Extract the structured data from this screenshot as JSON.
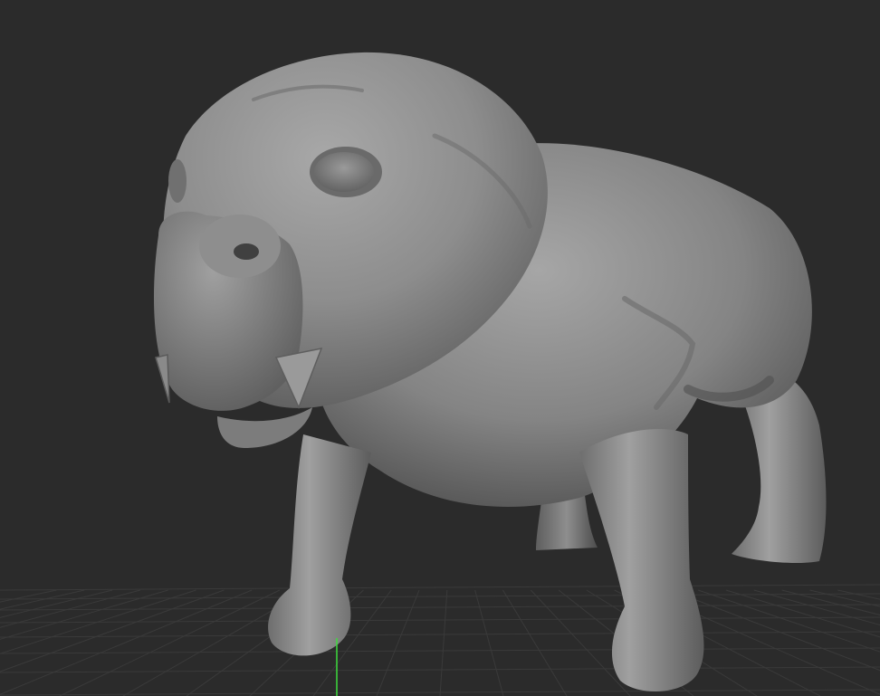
{
  "viewport": {
    "background_color": "#2b2b2b",
    "grid_color": "#3a3a3a",
    "axis_color": "#3ddc3d",
    "model_base_color": "#8a8a8a"
  },
  "model": {
    "subject": "sculpted dog",
    "material": "matcap-gray",
    "icon": "mesh-icon"
  },
  "floor_grid": {
    "visible": true
  },
  "axis_indicator": {
    "visible": true,
    "axis": "y"
  }
}
